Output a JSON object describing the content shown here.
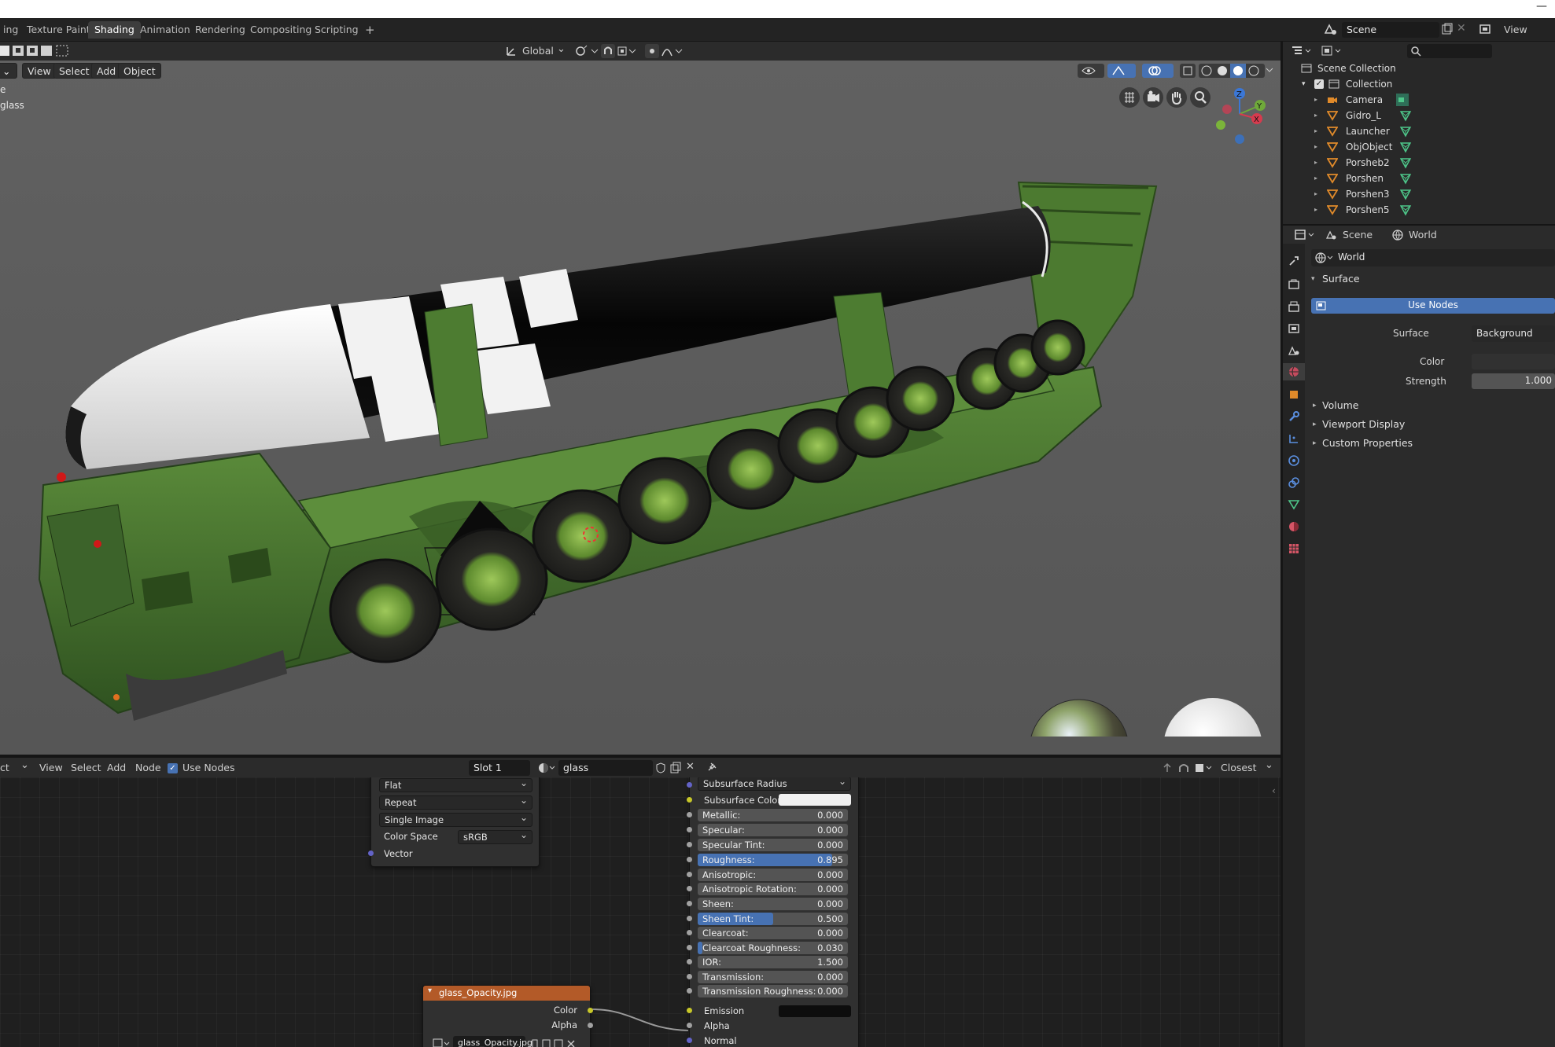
{
  "workspace_tabs": [
    "ing",
    "Texture Paint",
    "Shading",
    "Animation",
    "Rendering",
    "Compositing",
    "Scripting",
    "+"
  ],
  "active_tab": "Shading",
  "top_right": {
    "scene": "Scene",
    "view_layer": "View Layer"
  },
  "viewport": {
    "transform_orientation": "Global",
    "menu": [
      "View",
      "Select",
      "Add",
      "Object"
    ],
    "overlay_text": [
      "e",
      "glass"
    ],
    "gizmo_axes": {
      "z": "Z",
      "y": "Y",
      "x": "X"
    }
  },
  "outliner": {
    "root": "Scene Collection",
    "collection": "Collection",
    "items": [
      "Camera",
      "Gidro_L",
      "Launcher",
      "ObjObject",
      "Porsheb2",
      "Porshen",
      "Porshen3",
      "Porshen5"
    ]
  },
  "properties": {
    "tabs": {
      "scene": "Scene",
      "world": "World"
    },
    "world_name": "World",
    "surface_header": "Surface",
    "use_nodes": "Use Nodes",
    "surface_label": "Surface",
    "surface_value": "Background",
    "color_label": "Color",
    "strength_label": "Strength",
    "strength_value": "1.000",
    "sections": [
      "Volume",
      "Viewport Display",
      "Custom Properties"
    ]
  },
  "node_editor": {
    "left_label": "ct",
    "menu": [
      "View",
      "Select",
      "Add",
      "Node"
    ],
    "use_nodes": "Use Nodes",
    "slot": "Slot 1",
    "material": "glass",
    "snap": "Closest",
    "image_node": {
      "options": [
        "Flat",
        "Repeat",
        "Single Image"
      ],
      "color_space_label": "Color Space",
      "color_space_value": "sRGB",
      "vector": "Vector"
    },
    "opacity_node": {
      "title": "glass_Opacity.jpg",
      "outputs": [
        "Color",
        "Alpha"
      ],
      "image_field": "glass_Opacity.jpg"
    },
    "bsdf": {
      "subsurface_radius": "Subsurface Radius",
      "subsurface_color": "Subsurface Color",
      "rows": [
        {
          "label": "Metallic:",
          "value": "0.000",
          "fill": 0
        },
        {
          "label": "Specular:",
          "value": "0.000",
          "fill": 0
        },
        {
          "label": "Specular Tint:",
          "value": "0.000",
          "fill": 0
        },
        {
          "label": "Roughness:",
          "value": "0.895",
          "fill": 0.895
        },
        {
          "label": "Anisotropic:",
          "value": "0.000",
          "fill": 0
        },
        {
          "label": "Anisotropic Rotation:",
          "value": "0.000",
          "fill": 0
        },
        {
          "label": "Sheen:",
          "value": "0.000",
          "fill": 0
        },
        {
          "label": "Sheen Tint:",
          "value": "0.500",
          "fill": 0.5
        },
        {
          "label": "Clearcoat:",
          "value": "0.000",
          "fill": 0
        },
        {
          "label": "Clearcoat Roughness:",
          "value": "0.030",
          "fill": 0.03
        },
        {
          "label": "IOR:",
          "value": "1.500",
          "fill": 0
        },
        {
          "label": "Transmission:",
          "value": "0.000",
          "fill": 0
        },
        {
          "label": "Transmission Roughness:",
          "value": "0.000",
          "fill": 0
        }
      ],
      "emission": "Emission",
      "alpha": "Alpha",
      "normal": "Normal"
    }
  },
  "colors": {
    "accent": "#4772b3",
    "node_header_orange": "#b35a28",
    "socket_yellow": "#c7c729",
    "socket_purple": "#6363c7",
    "object_green": "#3f6b2a"
  }
}
